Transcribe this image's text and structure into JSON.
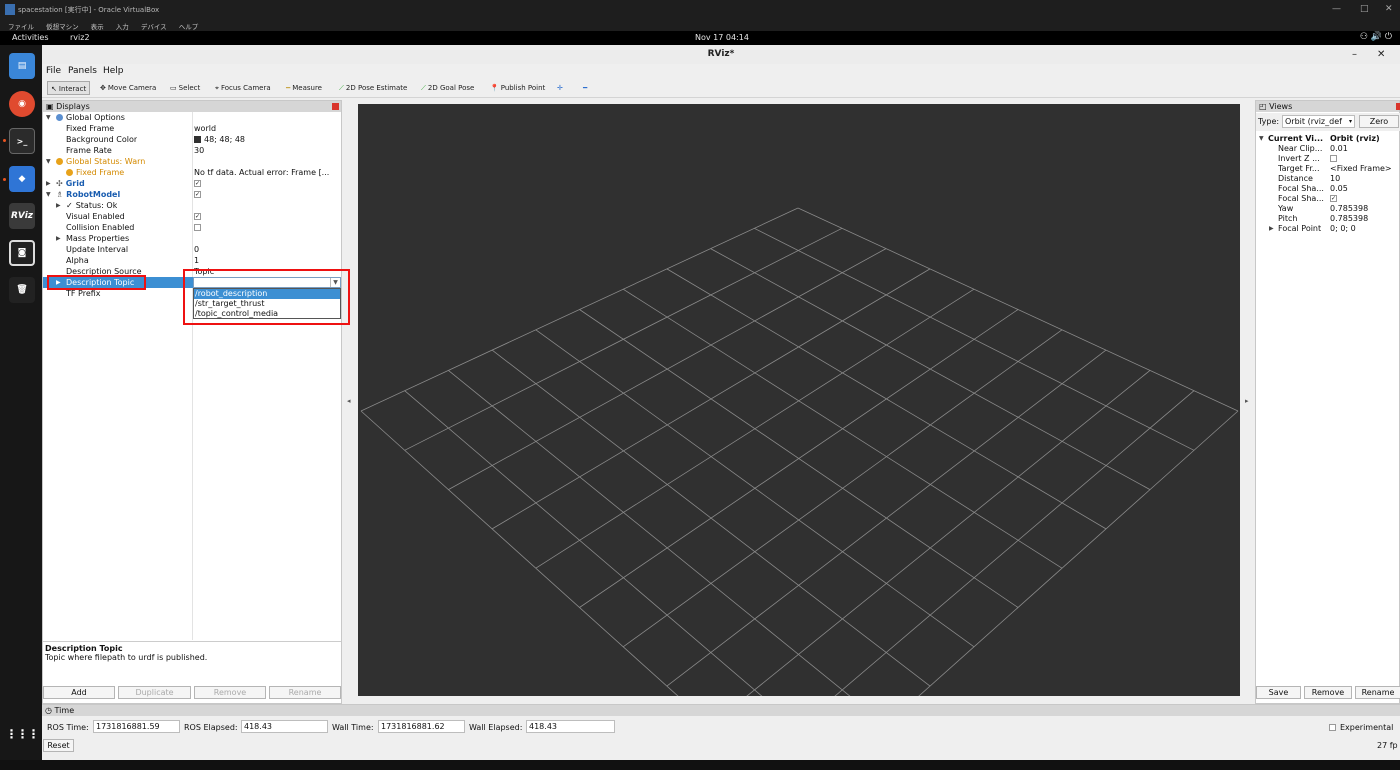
{
  "vbox": {
    "title": "spacestation [実行中] - Oracle VirtualBox",
    "menu": [
      "ファイル",
      "仮想マシン",
      "表示",
      "入力",
      "デバイス",
      "ヘルプ"
    ]
  },
  "topbar": {
    "activities": "Activities",
    "app": "rviz2",
    "clock": "Nov 17  04:14",
    "tray": "⚇  🔊  ⏻"
  },
  "dock": {
    "items": [
      {
        "name": "files",
        "label": "▤",
        "color": "#3a86d8"
      },
      {
        "name": "help",
        "label": "◉",
        "color": "#e04a2f"
      },
      {
        "name": "terminal",
        "label": ">_",
        "color": "#2b2b2b"
      },
      {
        "name": "app",
        "label": "◆",
        "color": "#2f75d6"
      },
      {
        "name": "rviz",
        "label": "RViz",
        "color": "#3a3a3a"
      },
      {
        "name": "screenshot",
        "label": "◙",
        "color": "#222"
      },
      {
        "name": "trash",
        "label": "🗑",
        "color": "#222"
      }
    ],
    "apps_grid": "⋮⋮⋮"
  },
  "rviz": {
    "title": "RViz*",
    "menu": [
      "File",
      "Panels",
      "Help"
    ],
    "toolbar": [
      {
        "label": "Interact",
        "icon": "↖"
      },
      {
        "label": "Move Camera",
        "icon": "✥"
      },
      {
        "label": "Select",
        "icon": "▭"
      },
      {
        "label": "Focus Camera",
        "icon": "⌖"
      },
      {
        "label": "Measure",
        "icon": "━"
      },
      {
        "label": "2D Pose Estimate",
        "icon": "⟋"
      },
      {
        "label": "2D Goal Pose",
        "icon": "⟋"
      },
      {
        "label": "Publish Point",
        "icon": "📍"
      },
      {
        "label": "",
        "icon": "✛"
      },
      {
        "label": "",
        "icon": "━"
      }
    ]
  },
  "displays": {
    "title": "Displays",
    "rows": [
      {
        "key": "Global Options",
        "value": ""
      },
      {
        "key": "Fixed Frame",
        "value": "world"
      },
      {
        "key": "Background Color",
        "value": "48; 48; 48"
      },
      {
        "key": "Frame Rate",
        "value": "30"
      },
      {
        "key": "Global Status: Warn",
        "value": ""
      },
      {
        "key": "Fixed Frame",
        "value": "No tf data.  Actual error: Frame [..."
      },
      {
        "key": "Grid",
        "value": "✓"
      },
      {
        "key": "RobotModel",
        "value": "✓"
      },
      {
        "key": "Status: Ok",
        "value": ""
      },
      {
        "key": "Visual Enabled",
        "value": "✓"
      },
      {
        "key": "Collision Enabled",
        "value": ""
      },
      {
        "key": "Mass Properties",
        "value": ""
      },
      {
        "key": "Update Interval",
        "value": "0"
      },
      {
        "key": "Alpha",
        "value": "1"
      },
      {
        "key": "Description Source",
        "value": "Topic"
      },
      {
        "key": "Description Topic",
        "value": ""
      },
      {
        "key": "TF Prefix",
        "value": ""
      }
    ],
    "dropdown_options": [
      "/robot_description",
      "/str_target_thrust",
      "/topic_control_media"
    ],
    "description_title": "Description Topic",
    "description_text": "Topic where filepath to urdf is published.",
    "buttons": {
      "add": "Add",
      "duplicate": "Duplicate",
      "remove": "Remove",
      "rename": "Rename"
    }
  },
  "views": {
    "title": "Views",
    "type_label": "Type:",
    "type_value": "Orbit (rviz_def",
    "zero": "Zero",
    "rows": [
      {
        "key": "Current Vi...",
        "value": "Orbit (rviz)"
      },
      {
        "key": "Near Clip...",
        "value": "0.01"
      },
      {
        "key": "Invert Z ...",
        "value": ""
      },
      {
        "key": "Target Fr...",
        "value": "<Fixed Frame>"
      },
      {
        "key": "Distance",
        "value": "10"
      },
      {
        "key": "Focal Sha...",
        "value": "0.05"
      },
      {
        "key": "Focal Sha...",
        "value": "✓"
      },
      {
        "key": "Yaw",
        "value": "0.785398"
      },
      {
        "key": "Pitch",
        "value": "0.785398"
      },
      {
        "key": "Focal Point",
        "value": "0; 0; 0"
      }
    ],
    "buttons": {
      "save": "Save",
      "remove": "Remove",
      "rename": "Rename"
    }
  },
  "time": {
    "title": "Time",
    "ros_time_label": "ROS Time:",
    "ros_time": "1731816881.59",
    "ros_elapsed_label": "ROS Elapsed:",
    "ros_elapsed": "418.43",
    "wall_time_label": "Wall Time:",
    "wall_time": "1731816881.62",
    "wall_elapsed_label": "Wall Elapsed:",
    "wall_elapsed": "418.43",
    "experimental": "Experimental",
    "reset": "Reset",
    "fps": "27 fp"
  },
  "colors": {
    "accent": "#3c8fd3",
    "warn": "#d48a00",
    "view_bg": "#303030",
    "highlight": "#e11111"
  }
}
